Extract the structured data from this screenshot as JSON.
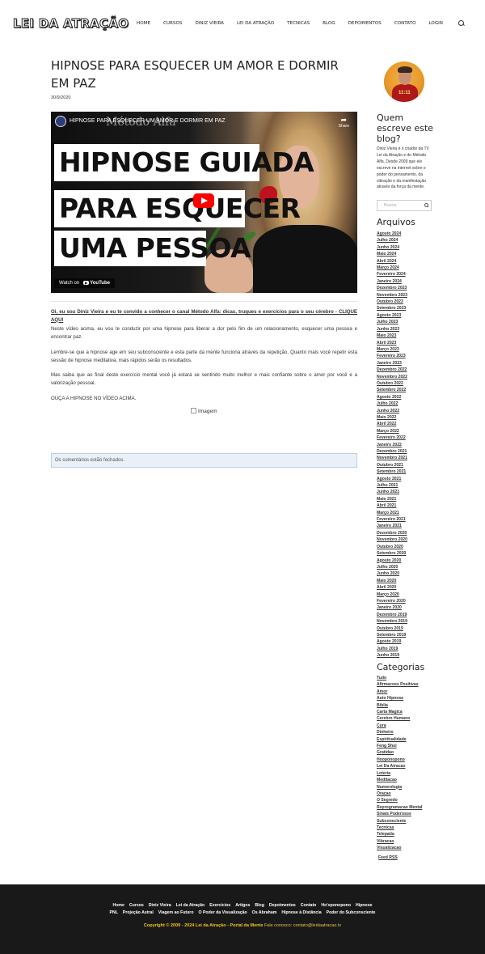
{
  "header": {
    "logo": "LEI DA ATRAÇÃO",
    "nav": [
      "Home",
      "CURSOS",
      "DINIZ VIEIRA",
      "LEI DA ATRAÇÃO",
      "TECNICAS",
      "BLOG",
      "DEPOIMENTOS",
      "CONTATO",
      "LOGIN"
    ],
    "search_icon": "search-icon"
  },
  "post": {
    "title": "HIPNOSE PARA ESQUECER UM AMOR E DORMIR EM PAZ",
    "date": "30/9/2020",
    "video": {
      "title": "HIPNOSE PARA ESQUECER UM AMOR E DORMIR EM PAZ",
      "ghost_title": "Método Alfa",
      "share_label": "Share",
      "banner_lines": [
        "HIPNOSE GUIADA",
        "PARA ESQUECER",
        "UMA PESSOA"
      ],
      "watch_on": "Watch on",
      "youtube": "YouTube"
    },
    "cta": "Oi, eu sou Diniz Vieira e eu te convido a conhecer o canal Método Alfa: dicas, truques e exercícios para o seu cérebro - CLIQUE AQUI",
    "paragraphs": [
      "Neste vídeo acima, eu vou te conduzir por uma hipnose para liberar a dor pelo fim de um relacionamento, esquecer uma pessoa e encontrar paz.",
      "Lembre-se que a hipnose age em seu subconsciente e esta parte da mente funciona através da repetição. Quanto mais você repetir esta sessão de hipnose meditativa, mais rápidos serão os resultados.",
      "Mas saiba que ao final deste exercício mental você já estará se sentindo muito melhor e mais confiante sobre o amor por você e a valorização pessoal.",
      "OUÇA A HIPNOSE NO VÍDEO ACIMA."
    ],
    "image_alt": "Imagem",
    "comments_closed": "Os comentários estão fechados."
  },
  "sidebar": {
    "avatar_text": "11:11",
    "who_title": "Quem escreve este blog?",
    "who_text": "Diniz Vieira é o criador da TV Lei da Atração e do Método Alfa. Desde 2009 que ele escreve na internet sobre o poder do pensamento, da vibração e da manifestação através da força da mente.",
    "search_placeholder": "Busca",
    "archives_title": "Arquivos",
    "archives": [
      "Agosto 2024",
      "Julho 2024",
      "Junho 2024",
      "Maio 2024",
      "Abril 2024",
      "Março 2024",
      "Fevereiro 2024",
      "Janeiro 2024",
      "Dezembro 2023",
      "Novembro 2023",
      "Outubro 2023",
      "Setembro 2023",
      "Agosto 2023",
      "Julho 2023",
      "Junho 2023",
      "Maio 2023",
      "Abril 2023",
      "Março 2023",
      "Fevereiro 2023",
      "Janeiro 2023",
      "Dezembro 2022",
      "Novembro 2022",
      "Outubro 2022",
      "Setembro 2022",
      "Agosto 2022",
      "Julho 2022",
      "Junho 2022",
      "Maio 2022",
      "Abril 2022",
      "Março 2022",
      "Fevereiro 2022",
      "Janeiro 2022",
      "Dezembro 2021",
      "Novembro 2021",
      "Outubro 2021",
      "Setembro 2021",
      "Agosto 2021",
      "Julho 2021",
      "Junho 2021",
      "Maio 2021",
      "Abril 2021",
      "Março 2021",
      "Fevereiro 2021",
      "Janeiro 2021",
      "Dezembro 2020",
      "Novembro 2020",
      "Outubro 2020",
      "Setembro 2020",
      "Agosto 2020",
      "Julho 2020",
      "Junho 2020",
      "Maio 2020",
      "Abril 2020",
      "Março 2020",
      "Fevereiro 2020",
      "Janeiro 2020",
      "Dezembro 2019",
      "Novembro 2019",
      "Outubro 2019",
      "Setembro 2019",
      "Agosto 2019",
      "Julho 2019",
      "Junho 2019"
    ],
    "categories_title": "Categorias",
    "categories": [
      "Tudo",
      "Afirmacoes Positivas",
      "Amor",
      "Auto Hipnose",
      "Biblia",
      "Carta Magica",
      "Cerebro Humano",
      "Cura",
      "Dinheiro",
      "Espiritualidade",
      "Feng Shui",
      "Gratidao",
      "Hooponopono",
      "Lei Da Atracao",
      "Loteria",
      "Meditacao",
      "Numerologia",
      "Oracao",
      "O Segredo",
      "Reprogramacao Mental",
      "Sinais Poderosos",
      "Subconsciente",
      "Tecnicas",
      "Telepatia",
      "Vibracao",
      "Visualizacao"
    ],
    "feed": "Feed RSS"
  },
  "footer": {
    "links_row1": [
      "Home",
      "Cursos",
      "Diniz Vieira",
      "Lei da Atração",
      "Exercícios",
      "Artigos",
      "Blog",
      "Depoimentos",
      "Contato",
      "Ho'oponopono",
      "Hipnose"
    ],
    "links_row2": [
      "PNL",
      "Projeção Astral",
      "Viagem ao Futuro",
      "O Poder da Visualização",
      "Os Abraham",
      "Hipnose à Distância",
      "Poder do Subconsciente"
    ],
    "copyright": "Copyright © 2009 - 2024 Lei da Atração - Portal da Mente",
    "contact": "Fale conosco: contato@leidaatracao.tv"
  }
}
